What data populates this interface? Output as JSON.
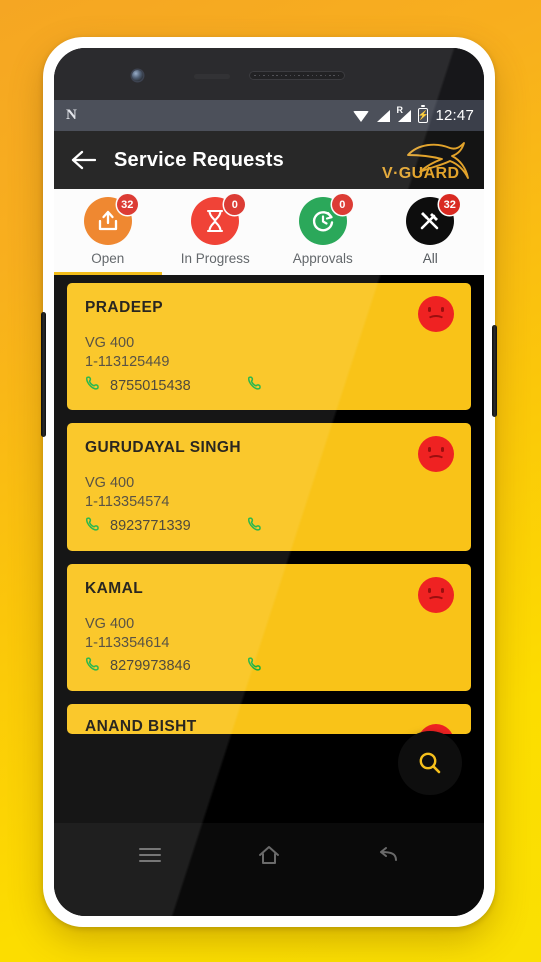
{
  "statusbar": {
    "os_logo": "N",
    "wifi_icon": "wifi-icon",
    "signal_icon": "signal-icon",
    "roaming_label": "R",
    "battery_icon": "battery-charging-icon",
    "clock": "12:47"
  },
  "appbar": {
    "back_icon": "back-arrow-icon",
    "title": "Service Requests",
    "brand_name": "V-GUARD",
    "brand_icon": "kangaroo-icon",
    "brand_color": "#E2A32B"
  },
  "tabs": {
    "active_index": 0,
    "indicator_color": "#F2B705",
    "items": [
      {
        "label": "Open",
        "badge": "32",
        "icon": "upload-box-icon",
        "color": "#EE7D1E"
      },
      {
        "label": "In Progress",
        "badge": "0",
        "icon": "hourglass-icon",
        "color": "#EF3124"
      },
      {
        "label": "Approvals",
        "badge": "0",
        "icon": "clock-refresh-icon",
        "color": "#17A04B"
      },
      {
        "label": "All",
        "badge": "32",
        "icon": "tools-icon",
        "color": "#0D0D0D"
      }
    ]
  },
  "list": {
    "card_color": "#F9C318",
    "status_icon": "sad-face-icon",
    "call_icon": "phone-call-icon",
    "cards": [
      {
        "name": "PRADEEP",
        "model": "VG 400",
        "id": "1-113125449",
        "phone": "8755015438"
      },
      {
        "name": "GURUDAYAL SINGH",
        "model": "VG 400",
        "id": "1-113354574",
        "phone": "8923771339"
      },
      {
        "name": "KAMAL",
        "model": "VG 400",
        "id": "1-113354614",
        "phone": "8279973846"
      },
      {
        "name": "ANAND BISHT",
        "model": "",
        "id": "",
        "phone": ""
      }
    ]
  },
  "fab": {
    "icon": "search-icon",
    "color": "#0E0E0E",
    "icon_color": "#F6C01C"
  },
  "navbar": {
    "items": [
      {
        "icon": "menu-icon"
      },
      {
        "icon": "home-icon"
      },
      {
        "icon": "back-icon"
      }
    ]
  }
}
